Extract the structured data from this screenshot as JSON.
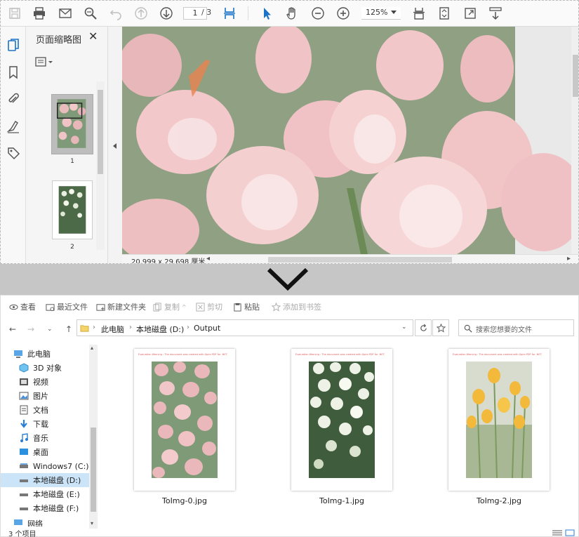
{
  "pdf": {
    "page_current": "1",
    "page_total": "/ 3",
    "zoom": "125%",
    "thumbnail_panel_title": "页面缩略图",
    "thumbnails": [
      {
        "label": "1"
      },
      {
        "label": "2"
      }
    ],
    "page_size": "20.999 x 29.698 厘米"
  },
  "explorer": {
    "commands": {
      "view": "查看",
      "recent": "最近文件",
      "new_folder": "新建文件夹",
      "copy": "复制",
      "cut": "剪切",
      "paste": "粘贴",
      "add_bookmark": "添加到书签"
    },
    "breadcrumb": [
      "此电脑",
      "本地磁盘 (D:)",
      "Output"
    ],
    "search_placeholder": "搜索您想要的文件",
    "nav_items": [
      {
        "label": "此电脑",
        "icon": "computer-icon"
      },
      {
        "label": "3D 对象",
        "icon": "cube-icon"
      },
      {
        "label": "视频",
        "icon": "video-icon"
      },
      {
        "label": "图片",
        "icon": "picture-icon"
      },
      {
        "label": "文档",
        "icon": "document-icon"
      },
      {
        "label": "下载",
        "icon": "download-icon"
      },
      {
        "label": "音乐",
        "icon": "music-icon"
      },
      {
        "label": "桌面",
        "icon": "desktop-icon"
      },
      {
        "label": "Windows7 (C:)",
        "icon": "drive-icon"
      },
      {
        "label": "本地磁盘 (D:)",
        "icon": "drive-icon",
        "selected": true
      },
      {
        "label": "本地磁盘 (E:)",
        "icon": "drive-icon"
      },
      {
        "label": "本地磁盘 (F:)",
        "icon": "drive-icon"
      },
      {
        "label": "网络",
        "icon": "network-icon"
      }
    ],
    "files": [
      {
        "name": "ToImg-0.jpg",
        "theme": "pink tulips"
      },
      {
        "name": "ToImg-1.jpg",
        "theme": "white tulips"
      },
      {
        "name": "ToImg-2.jpg",
        "theme": "yellow tulips"
      }
    ],
    "item_count": "3 个项目"
  },
  "colors": {
    "accent": "#1a73c7",
    "selection": "#cce4f7",
    "separator": "#c6c6c6"
  }
}
